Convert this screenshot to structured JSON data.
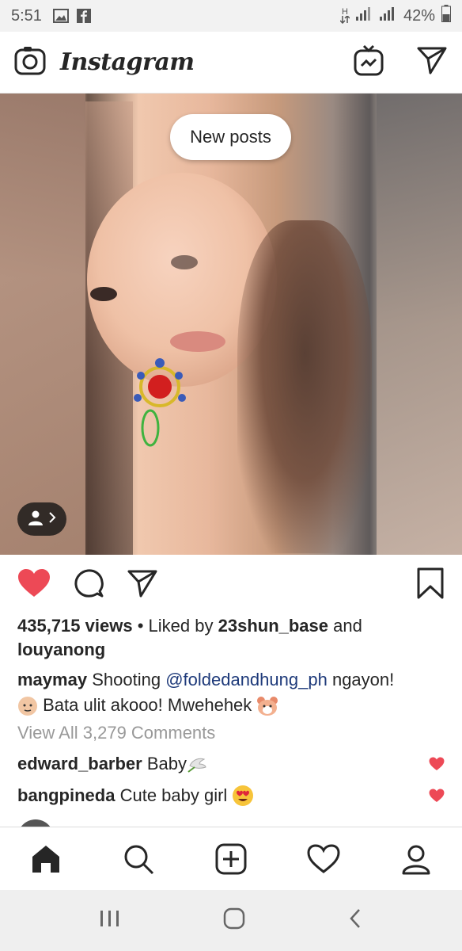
{
  "status_bar": {
    "time": "5:51",
    "network_label": "H",
    "battery": "42%"
  },
  "header": {
    "logo": "Instagram"
  },
  "post": {
    "new_posts_label": "New posts",
    "views": "435,715 views",
    "liked_by_prefix": "Liked by",
    "liked_user": "23shun_base",
    "liked_and": "and",
    "liked_user2": "louyanong",
    "author": "maymay",
    "caption_text1": "Shooting",
    "caption_mention": "@foldedandhung_ph",
    "caption_text2": "ngayon!",
    "caption_text3": "Bata ulit akooo! Mwehehek",
    "view_all_comments": "View All 3,279 Comments",
    "comments": [
      {
        "user": "edward_barber",
        "text": "Baby"
      },
      {
        "user": "bangpineda",
        "text": "Cute baby girl"
      }
    ]
  },
  "colors": {
    "like_red": "#ed4956",
    "mention_blue": "#1e3a7a",
    "muted_gray": "#999999"
  },
  "icons": {
    "header_left": "camera-icon",
    "header_igtv": "igtv-icon",
    "header_direct": "direct-message-icon",
    "nav": [
      "home-icon",
      "search-icon",
      "add-post-icon",
      "activity-heart-icon",
      "profile-icon"
    ],
    "system_nav": [
      "recent-apps-icon",
      "home-button-icon",
      "back-icon"
    ]
  }
}
